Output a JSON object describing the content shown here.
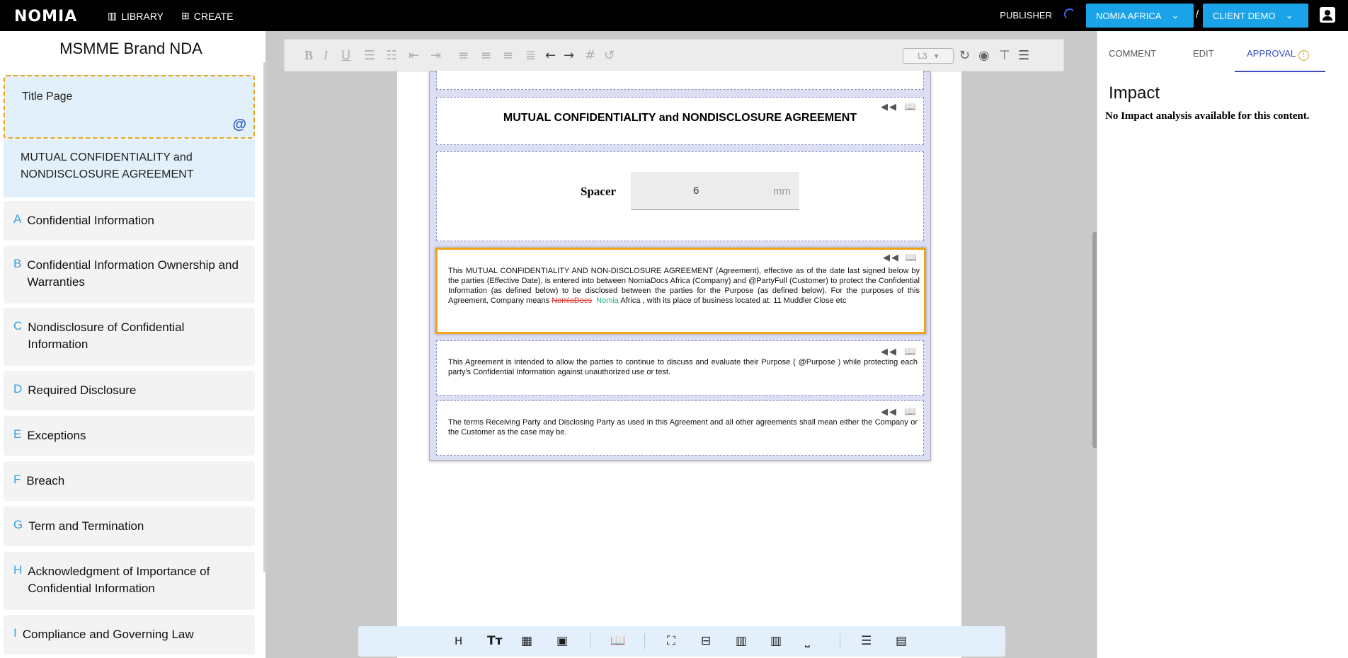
{
  "topbar": {
    "logo": "NOMIA",
    "library_label": "LIBRARY",
    "create_label": "CREATE",
    "publisher_label": "PUBLISHER",
    "org_label": "NOMIA AFRICA",
    "separator": "/",
    "client_label": "CLIENT DEMO"
  },
  "sidebar": {
    "doc_title": "MSMME Brand NDA",
    "title_page": "Title Page",
    "at_symbol": "@",
    "first_item": "MUTUAL CONFIDENTIALITY and NONDISCLOSURE AGREEMENT",
    "sections": [
      {
        "letter": "A",
        "label": "Confidential Information"
      },
      {
        "letter": "B",
        "label": "Confidential Information Ownership and Warranties"
      },
      {
        "letter": "C",
        "label": "Nondisclosure of Confidential Information"
      },
      {
        "letter": "D",
        "label": "Required Disclosure"
      },
      {
        "letter": "E",
        "label": "Exceptions"
      },
      {
        "letter": "F",
        "label": "Breach"
      },
      {
        "letter": "G",
        "label": "Term and Termination"
      },
      {
        "letter": "H",
        "label": "Acknowledgment of Importance of Confidential Information"
      },
      {
        "letter": "I",
        "label": "Compliance and Governing Law"
      }
    ]
  },
  "toolbar": {
    "level_value": "L3",
    "icons": [
      "bold-icon",
      "italic-icon",
      "underline-icon",
      "bullet-list-icon",
      "numbered-list-icon",
      "outdent-icon",
      "indent-icon",
      "align-left-icon",
      "align-center-icon",
      "align-right-icon",
      "justify-icon",
      "undo-icon",
      "redo-icon",
      "hash-icon",
      "history-icon",
      "refresh-icon",
      "eye-icon",
      "paint-roller-icon",
      "menu-icon"
    ]
  },
  "document": {
    "heading": "MUTUAL CONFIDENTIALITY and NONDISCLOSURE AGREEMENT",
    "spacer_label": "Spacer",
    "spacer_value": "6",
    "spacer_unit": "mm",
    "para1_part1": "This MUTUAL CONFIDENTIALITY AND NON-DISCLOSURE AGREEMENT (Agreement), effective as of the date last signed below by the parties (Effective Date), is entered into between NomiaDocs Africa (Company) and @PartyFull (Customer) to protect the Confidential Information (as defined below) to be disclosed between the parties for the Purpose (as defined below). For the purposes of this Agreement, Company means ",
    "para1_deleted": "NomiaDocs",
    "para1_inserted": "Nomia",
    "para1_part2": " Africa , with its place of business located at: 11 Muddler Close etc",
    "para2": "This Agreement is intended to allow the parties to continue to discuss and evaluate their Purpose ( @Purpose ) while protecting each party's Confidential Information against unauthorized use or test.",
    "para3": "The terms Receiving Party and Disclosing Party as used in this Agreement and all other agreements shall mean either the Company or the Customer as the case may be."
  },
  "right_panel": {
    "tab_comment": "COMMENT",
    "tab_edit": "EDIT",
    "tab_approval": "APPROVAL",
    "impact_title": "Impact",
    "impact_message": "No Impact analysis available for this content."
  },
  "colors": {
    "accent_blue": "#1aa3e8",
    "active_orange": "#f0a41a",
    "tab_active": "#3a4cc4",
    "deleted_red": "#d9342b",
    "inserted_green": "#1bb08a"
  }
}
